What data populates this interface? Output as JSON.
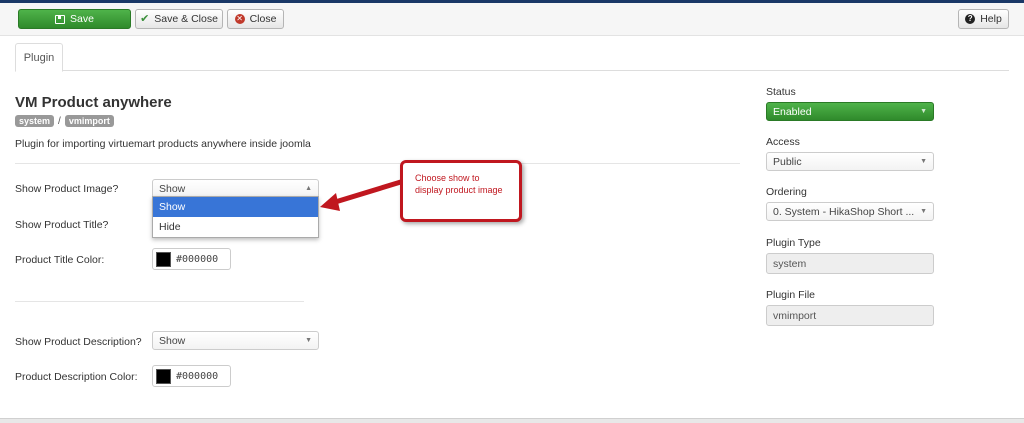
{
  "toolbar": {
    "save_label": "Save",
    "save_close_label": "Save & Close",
    "close_label": "Close",
    "help_label": "Help"
  },
  "tabs": [
    {
      "label": "Plugin"
    }
  ],
  "plugin": {
    "title": "VM Product anywhere",
    "badges": [
      "system",
      "vmimport"
    ],
    "separator": "/",
    "description": "Plugin for importing virtuemart products anywhere inside joomla"
  },
  "fields": {
    "show_image": {
      "label": "Show Product Image?",
      "value": "Show"
    },
    "show_title": {
      "label": "Show Product Title?"
    },
    "title_color": {
      "label": "Product Title Color:",
      "value": "#000000"
    },
    "show_description": {
      "label": "Show Product Description?",
      "value": "Show"
    },
    "description_color": {
      "label": "Product Description Color:",
      "value": "#000000"
    }
  },
  "dropdown": {
    "options": [
      "Show",
      "Hide"
    ],
    "highlighted": "Show"
  },
  "callout": {
    "line1": "Choose show  to",
    "line2": "display product image"
  },
  "sidebar": {
    "status": {
      "label": "Status",
      "value": "Enabled"
    },
    "access": {
      "label": "Access",
      "value": "Public"
    },
    "ordering": {
      "label": "Ordering",
      "value": "0. System - HikaShop Short ..."
    },
    "plugin_type": {
      "label": "Plugin Type",
      "value": "system"
    },
    "plugin_file": {
      "label": "Plugin File",
      "value": "vmimport"
    }
  },
  "colors": {
    "success": "#3a9d36",
    "callout": "#c0171f",
    "highlight": "#3875d7",
    "navbar": "#1a3867"
  }
}
